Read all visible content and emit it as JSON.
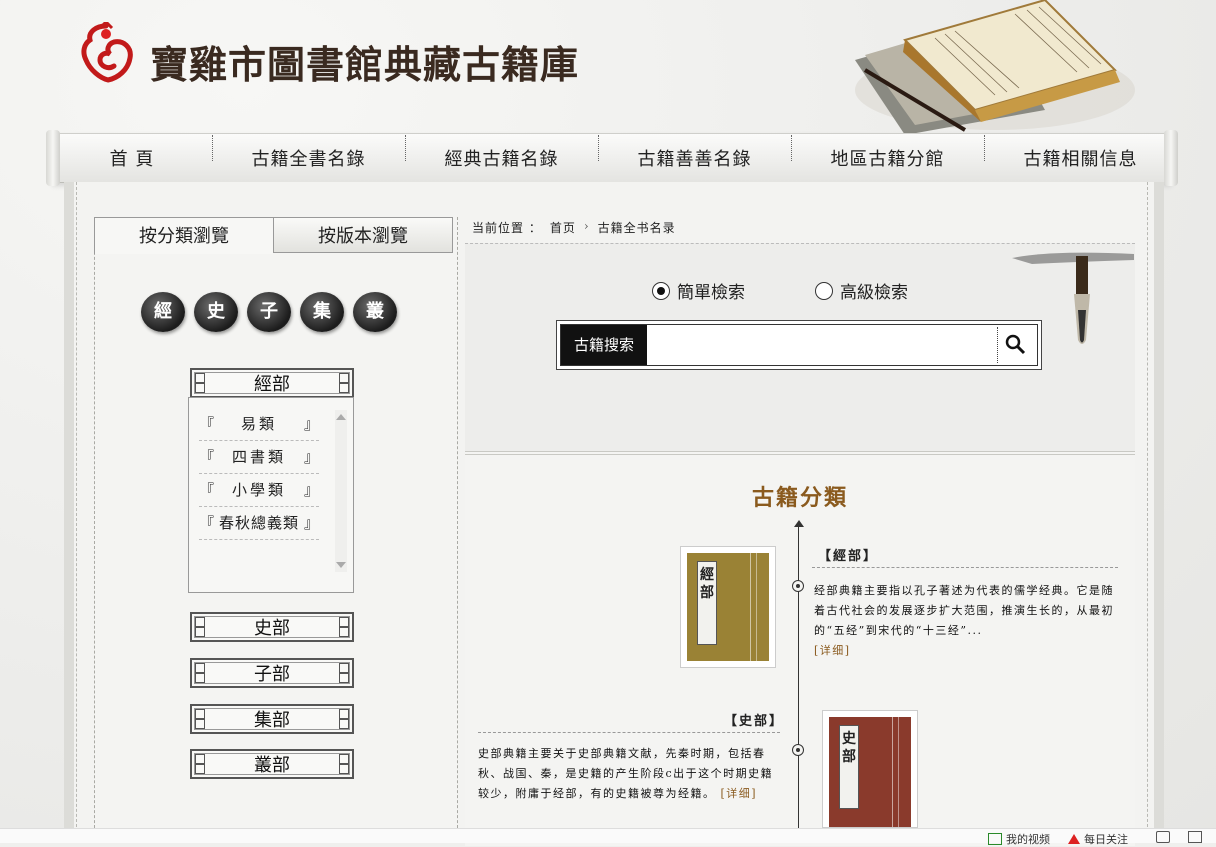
{
  "header": {
    "site_title": "寶雞市圖書館典藏古籍庫"
  },
  "nav": {
    "items": [
      "首 頁",
      "古籍全書名錄",
      "經典古籍名錄",
      "古籍善善名錄",
      "地區古籍分館",
      "古籍相關信息"
    ]
  },
  "left_panel": {
    "tabs": [
      "按分類瀏覽",
      "按版本瀏覽"
    ],
    "class_circles": [
      "經",
      "史",
      "子",
      "集",
      "叢"
    ],
    "categories": {
      "jing": "經部",
      "shi": "史部",
      "zi": "子部",
      "ji": "集部",
      "cong": "叢部"
    },
    "jing_subs": [
      {
        "open": "『",
        "name": "易類",
        "close": "』"
      },
      {
        "open": "『",
        "name": "四書類",
        "close": "』"
      },
      {
        "open": "『",
        "name": "小學類",
        "close": "』"
      },
      {
        "open": "『",
        "name": "春秋總義類",
        "close": "』"
      }
    ]
  },
  "breadcrumb": {
    "label": "当前位置 ：",
    "home": "首页",
    "arrow": "›",
    "current": "古籍全书名录"
  },
  "search": {
    "modes": [
      "簡單檢索",
      "高級檢索"
    ],
    "selected_mode": "簡單檢索",
    "label": "古籍搜索",
    "placeholder": "",
    "value": ""
  },
  "classification": {
    "title": "古籍分類",
    "entries": [
      {
        "heading": "【經部】",
        "book_label": "經部",
        "cover_color": "#9a8235",
        "description": "经部典籍主要指以孔子著述为代表的儒学经典。它是随着古代社会的发展逐步扩大范围，推演生长的，从最初的“五经”到宋代的“十三经”...",
        "more": "[详细]"
      },
      {
        "heading": "【史部】",
        "book_label": "史部",
        "cover_color": "#8a3a2c",
        "description": "史部典籍主要关于史部典籍文献，先秦时期，包括春秋、战国、秦，是史籍的产生阶段c出于这个时期史籍较少，附庸于经部，有的史籍被尊为经籍。",
        "more": "[详细]"
      }
    ]
  },
  "bottom_bar": {
    "items": [
      "我的视频",
      "每日关注"
    ]
  },
  "colors": {
    "accent": "#8a5a1e",
    "search_label_bg": "#111111"
  }
}
